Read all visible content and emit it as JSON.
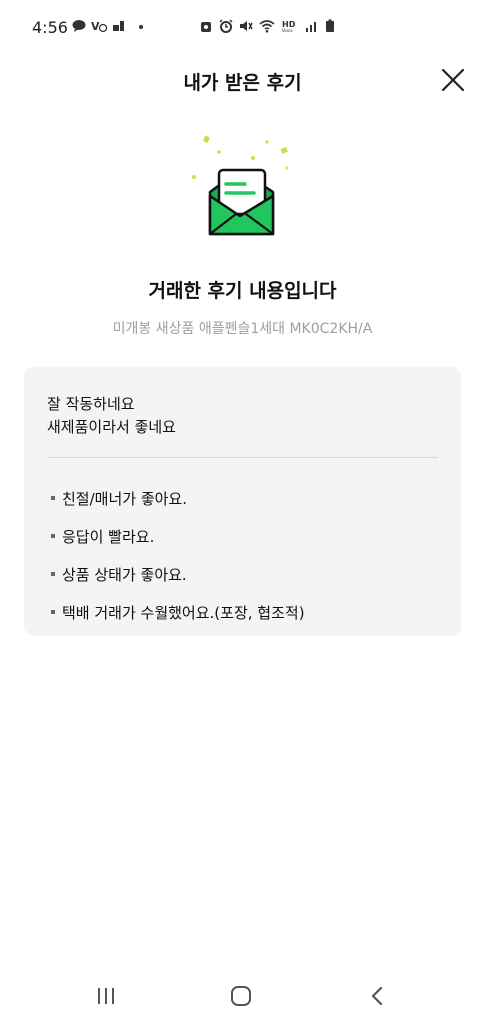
{
  "status_bar": {
    "time": "4:56",
    "left_icons": [
      "talk-icon",
      "volte-icon",
      "app-icon",
      "dot-icon"
    ],
    "right_icons": [
      "lock-icon",
      "alarm-icon",
      "mute-icon",
      "wifi-icon",
      "hd-voice-icon",
      "signal-icon",
      "battery-icon"
    ]
  },
  "header": {
    "title": "내가 받은 후기",
    "close_icon": "close-icon"
  },
  "hero": {
    "icon": "envelope-letter-icon",
    "accent_color": "#22c55e"
  },
  "headline": "거래한 후기 내용입니다",
  "product_name": "미개봉 새상품 애플펜슬1세대 MK0C2KH/A",
  "review": {
    "text_lines": [
      "잘 작동하네요",
      "새제품이라서 좋네요"
    ],
    "tags": [
      "친절/매너가 좋아요.",
      "응답이 빨라요.",
      "상품 상태가 좋아요.",
      "택배 거래가 수월했어요.(포장, 협조적)"
    ]
  },
  "nav_bar": {
    "buttons": [
      "recent-apps-icon",
      "home-icon",
      "back-icon"
    ]
  }
}
